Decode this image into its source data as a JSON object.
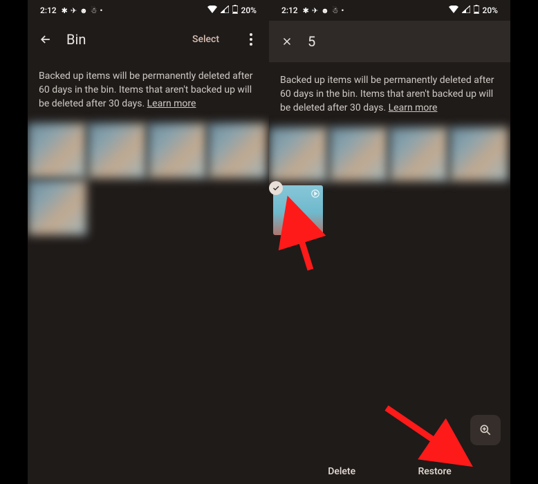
{
  "status": {
    "time": "2:12",
    "battery": "20%"
  },
  "left": {
    "title": "Bin",
    "select_label": "Select",
    "info": "Backed up items will be permanently deleted after 60 days in the bin. Items that aren't backed up will be deleted after 30 days. ",
    "learn_more": "Learn more"
  },
  "right": {
    "count": "5",
    "info": "Backed up items will be permanently deleted after 60 days in the bin. Items that aren't backed up will be deleted after 30 days. ",
    "learn_more": "Learn more",
    "delete_label": "Delete",
    "restore_label": "Restore"
  }
}
